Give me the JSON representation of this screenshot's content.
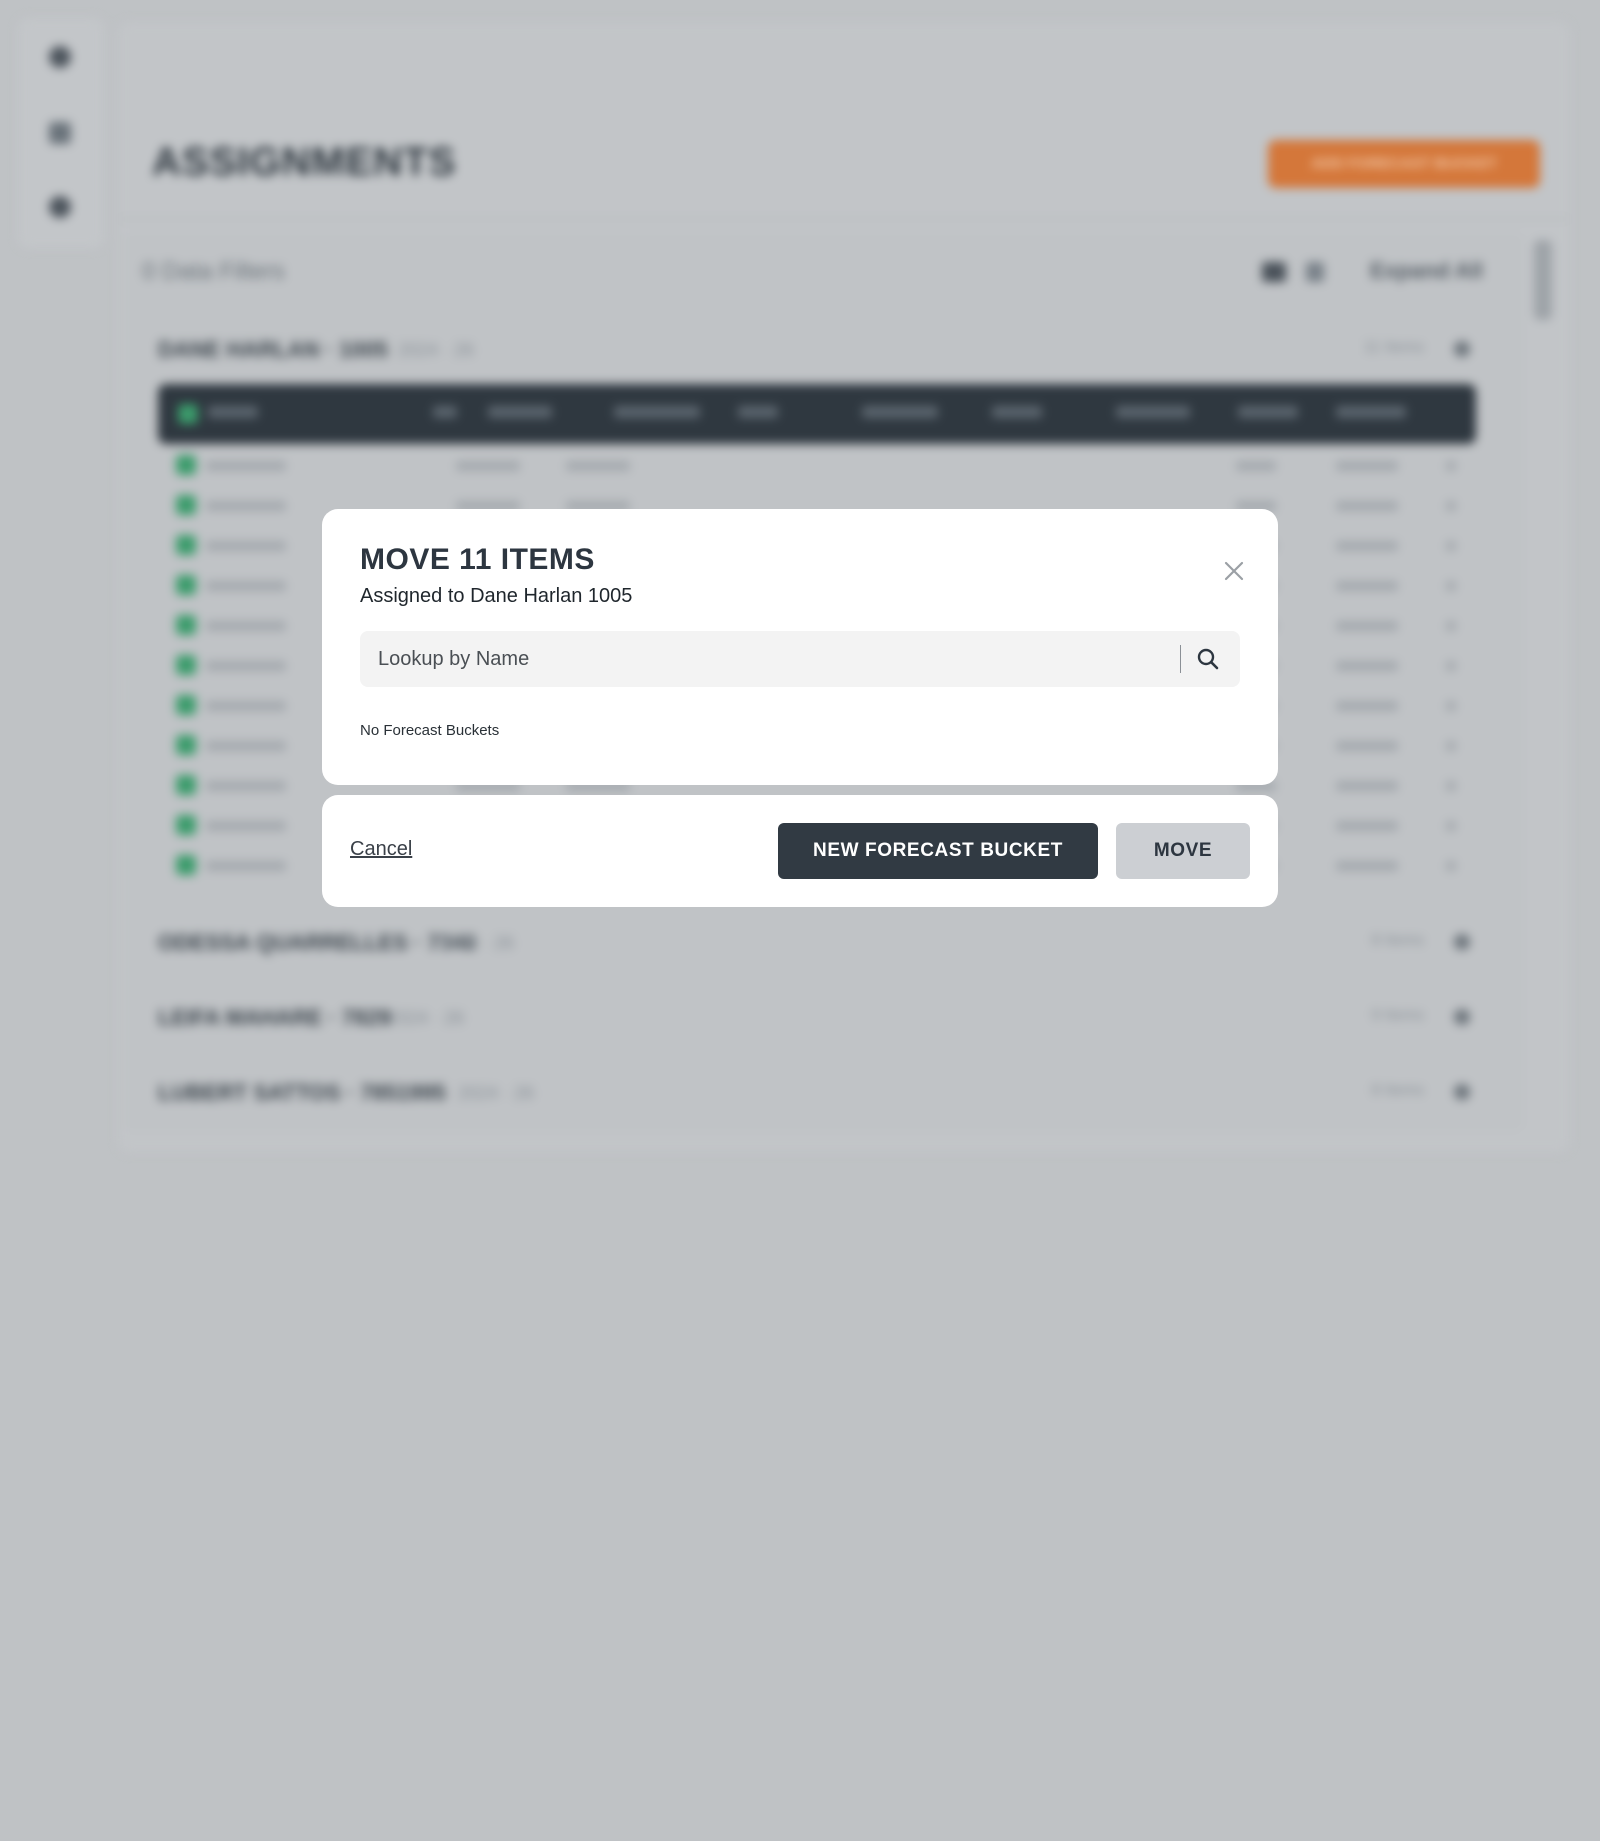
{
  "background": {
    "page_title": "ASSIGNMENTS",
    "add_button_label": "ADD FORECAST BUCKET",
    "filter_text": "0 Data Filters",
    "expand_all_label": "Expand All",
    "groups": [
      {
        "name": "DANE HARLAN · 1005",
        "meta": "2024 · 26",
        "count": "11 Items"
      },
      {
        "name": "ODESSA QUARRELLES · 7340",
        "meta": "2024 · 26",
        "count": "8 Items"
      },
      {
        "name": "LEIFA MAHARE · 7829",
        "meta": "2024 · 26",
        "count": "9 Items"
      },
      {
        "name": "LUBERT SATTOS · 7851995",
        "meta": "2024 · 26",
        "count": "8 Items"
      }
    ],
    "row_count": 11,
    "colors": {
      "accent": "#d4773a",
      "header": "#2f3840",
      "check": "#3c9c6c"
    }
  },
  "modal": {
    "title": "MOVE 11 ITEMS",
    "subtitle": "Assigned to Dane Harlan 1005",
    "search": {
      "placeholder": "Lookup by Name",
      "value": ""
    },
    "empty_message": "No Forecast Buckets",
    "cancel_label": "Cancel",
    "new_bucket_label": "NEW FORECAST BUCKET",
    "move_label": "MOVE",
    "icons": {
      "close": "close-icon",
      "search": "search-icon"
    }
  }
}
